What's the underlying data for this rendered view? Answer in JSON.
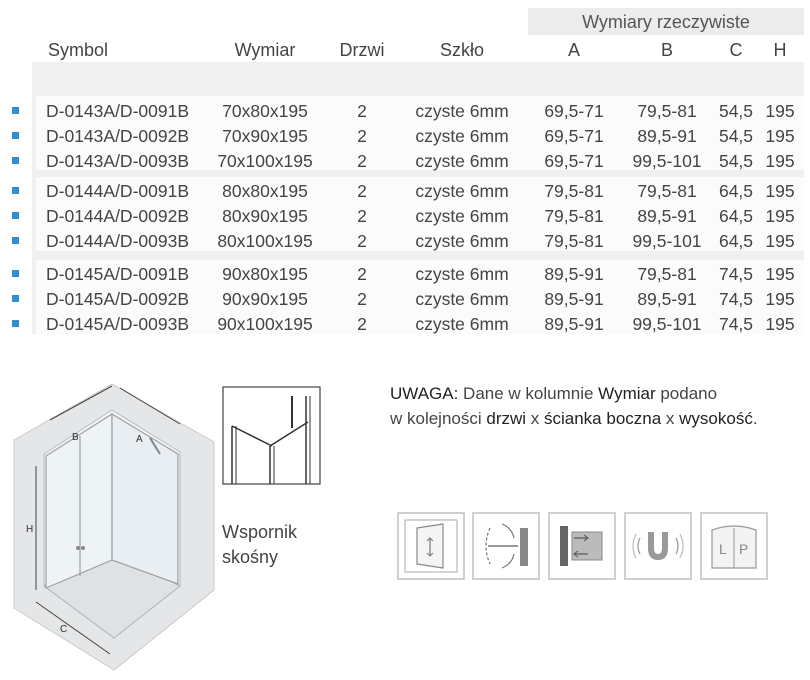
{
  "header": {
    "group_label": "Wymiary rzeczywiste",
    "columns": {
      "symbol": "Symbol",
      "wymiar": "Wymiar",
      "drzwi": "Drzwi",
      "szklo": "Szkło",
      "a": "A",
      "b": "B",
      "c": "C",
      "h": "H"
    }
  },
  "rows": [
    {
      "symbol": "D-0143A/D-0091B",
      "wymiar": "70x80x195",
      "drzwi": "2",
      "szklo": "czyste 6mm",
      "a": "69,5-71",
      "b": "79,5-81",
      "c": "54,5",
      "h": "195"
    },
    {
      "symbol": "D-0143A/D-0092B",
      "wymiar": "70x90x195",
      "drzwi": "2",
      "szklo": "czyste 6mm",
      "a": "69,5-71",
      "b": "89,5-91",
      "c": "54,5",
      "h": "195"
    },
    {
      "symbol": "D-0143A/D-0093B",
      "wymiar": "70x100x195",
      "drzwi": "2",
      "szklo": "czyste 6mm",
      "a": "69,5-71",
      "b": "99,5-101",
      "c": "54,5",
      "h": "195"
    },
    {
      "symbol": "D-0144A/D-0091B",
      "wymiar": "80x80x195",
      "drzwi": "2",
      "szklo": "czyste 6mm",
      "a": "79,5-81",
      "b": "79,5-81",
      "c": "64,5",
      "h": "195"
    },
    {
      "symbol": "D-0144A/D-0092B",
      "wymiar": "80x90x195",
      "drzwi": "2",
      "szklo": "czyste 6mm",
      "a": "79,5-81",
      "b": "89,5-91",
      "c": "64,5",
      "h": "195"
    },
    {
      "symbol": "D-0144A/D-0093B",
      "wymiar": "80x100x195",
      "drzwi": "2",
      "szklo": "czyste 6mm",
      "a": "79,5-81",
      "b": "99,5-101",
      "c": "64,5",
      "h": "195"
    },
    {
      "symbol": "D-0145A/D-0091B",
      "wymiar": "90x80x195",
      "drzwi": "2",
      "szklo": "czyste 6mm",
      "a": "89,5-91",
      "b": "79,5-81",
      "c": "74,5",
      "h": "195"
    },
    {
      "symbol": "D-0145A/D-0092B",
      "wymiar": "90x90x195",
      "drzwi": "2",
      "szklo": "czyste 6mm",
      "a": "89,5-91",
      "b": "89,5-91",
      "c": "74,5",
      "h": "195"
    },
    {
      "symbol": "D-0145A/D-0093B",
      "wymiar": "90x100x195",
      "drzwi": "2",
      "szklo": "czyste 6mm",
      "a": "89,5-91",
      "b": "99,5-101",
      "c": "74,5",
      "h": "195"
    }
  ],
  "diagram": {
    "label_a": "A",
    "label_b": "B",
    "label_c": "C",
    "label_h": "H"
  },
  "bracket": {
    "line1": "Wspornik",
    "line2": "skośny"
  },
  "note": {
    "line1_prefix": "UWAGA:",
    "line1_text": " Dane w kolumnie ",
    "line1_bold": "Wymiar",
    "line1_suffix": " podano",
    "line2_text": "w kolejności ",
    "line2_b1": "drzwi",
    "line2_x1": " x ",
    "line2_b2": "ścianka boczna",
    "line2_x2": " x ",
    "line2_b3": "wysokość",
    "line2_end": "."
  },
  "features": [
    {
      "icon": "sliding-door-icon"
    },
    {
      "icon": "door-swing-icon"
    },
    {
      "icon": "wall-profile-adjust-icon"
    },
    {
      "icon": "magnetic-seal-icon"
    },
    {
      "icon": "left-right-mount-icon",
      "left_letter": "L",
      "right_letter": "P"
    }
  ],
  "colors": {
    "bullet": "#2f8fd0",
    "table_bg": "#f0f0f0",
    "header_band": "#ececec"
  }
}
